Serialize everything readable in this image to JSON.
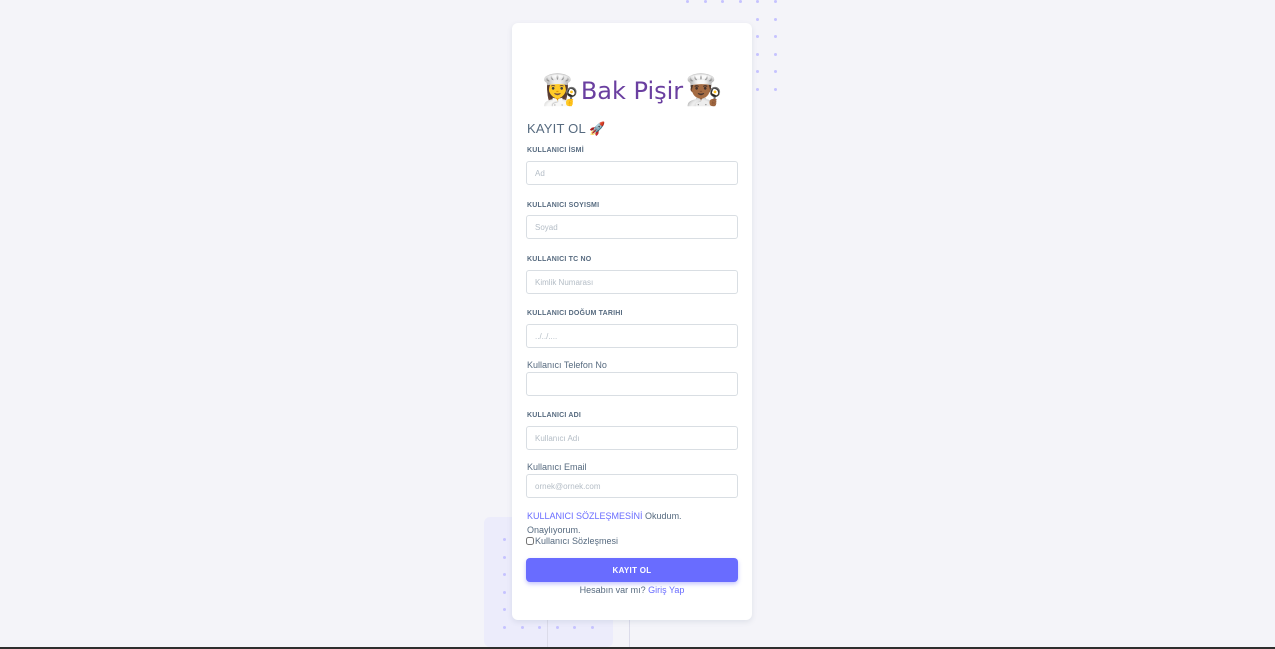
{
  "brand": {
    "name": "Bak Pişir",
    "left_icon": "👩‍🍳",
    "right_icon": "👨🏾‍🍳",
    "left_icon_name": "chef-woman-icon",
    "right_icon_name": "chef-man-icon"
  },
  "form": {
    "title": "KAYIT OL",
    "title_icon": "🚀",
    "fields": {
      "first_name": {
        "label": "KULLANICI İSMİ",
        "placeholder": "Ad",
        "value": ""
      },
      "last_name": {
        "label": "KULLANICI SOYISMI",
        "placeholder": "Soyad",
        "value": ""
      },
      "tc_no": {
        "label": "KULLANICI TC NO",
        "placeholder": "Kimlik Numarası",
        "value": ""
      },
      "birth_date": {
        "label": "KULLANICI DOĞUM TARIHI",
        "placeholder": "../../....",
        "value": ""
      },
      "phone": {
        "label": "Kullanıcı Telefon No",
        "placeholder": "",
        "value": ""
      },
      "username": {
        "label": "KULLANICI ADI",
        "placeholder": "Kullanıcı Adı",
        "value": ""
      },
      "email": {
        "label": "Kullanıcı Email",
        "placeholder": "ornek@ornek.com",
        "value": ""
      }
    },
    "agreement": {
      "link": "KULLANICI SÖZLEŞMESİNİ",
      "text": " Okudum. Onaylıyorum.",
      "checkbox_label": "Kullanıcı Sözleşmesi",
      "checked": false
    },
    "submit_label": "KAYIT OL",
    "login_prompt": "Hesabın var mı?",
    "login_link": "Giriş Yap"
  },
  "colors": {
    "primary": "#696cff",
    "brand_text": "#6a3fa0",
    "background": "#f4f4f9",
    "card": "#ffffff",
    "text": "#566a7f"
  }
}
